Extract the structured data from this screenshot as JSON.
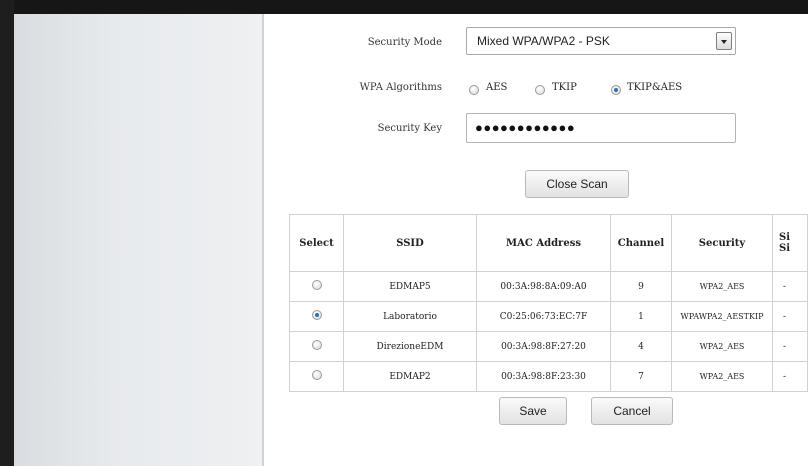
{
  "form": {
    "security_mode_label": "Security Mode",
    "security_mode_value": "Mixed WPA/WPA2 - PSK",
    "wpa_algorithms_label": "WPA Algorithms",
    "algorithms": [
      {
        "label": "AES",
        "checked": false
      },
      {
        "label": "TKIP",
        "checked": false
      },
      {
        "label": "TKIP&AES",
        "checked": true
      }
    ],
    "security_key_label": "Security Key",
    "security_key_value": "●●●●●●●●●●●●",
    "close_scan_label": "Close Scan"
  },
  "scan_table": {
    "headers": [
      "Select",
      "SSID",
      "MAC Address",
      "Channel",
      "Security",
      "Si\nSi"
    ],
    "rows": [
      {
        "selected": false,
        "ssid": "EDMAP5",
        "mac": "00:3A:98:8A:09:A0",
        "channel": "9",
        "security": "WPA2_AES",
        "signal": "-"
      },
      {
        "selected": true,
        "ssid": "Laboratorio",
        "mac": "C0:25:06:73:EC:7F",
        "channel": "1",
        "security": "WPAWPA2_AESTKIP",
        "signal": "-"
      },
      {
        "selected": false,
        "ssid": "DirezioneEDM",
        "mac": "00:3A:98:8F:27:20",
        "channel": "4",
        "security": "WPA2_AES",
        "signal": "-"
      },
      {
        "selected": false,
        "ssid": "EDMAP2",
        "mac": "00:3A:98:8F:23:30",
        "channel": "7",
        "security": "WPA2_AES",
        "signal": "-"
      }
    ]
  },
  "actions": {
    "save_label": "Save",
    "cancel_label": "Cancel"
  }
}
